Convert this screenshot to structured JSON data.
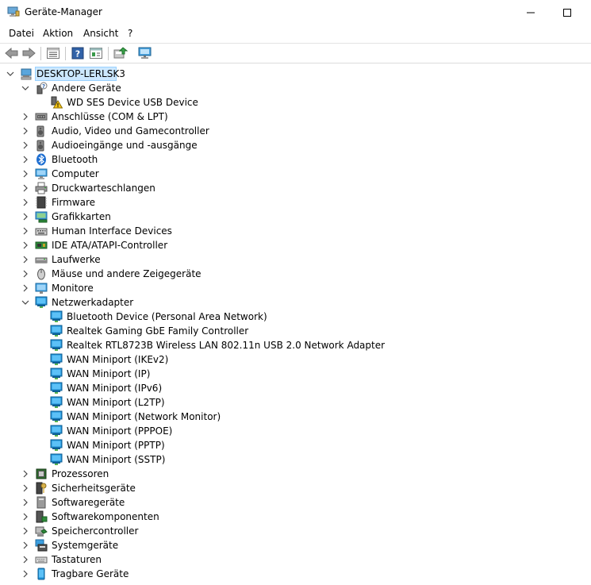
{
  "window": {
    "title": "Geräte-Manager"
  },
  "menu": {
    "items": [
      "Datei",
      "Aktion",
      "Ansicht",
      "?"
    ]
  },
  "toolbar": {
    "buttons": [
      "back-icon",
      "forward-icon",
      "properties-list-icon",
      "help-icon",
      "view-icon",
      "update-driver-icon",
      "monitor-scan-icon"
    ]
  },
  "tree": {
    "root": "DESKTOP-LERLSK3",
    "categories": [
      {
        "label": "Andere Geräte",
        "expanded": true,
        "icon": "unknown-device-icon",
        "children": [
          {
            "label": "WD SES Device USB Device",
            "icon": "warning-device-icon"
          }
        ]
      },
      {
        "label": "Anschlüsse (COM & LPT)",
        "icon": "port-icon"
      },
      {
        "label": "Audio, Video und Gamecontroller",
        "icon": "speaker-icon"
      },
      {
        "label": "Audioeingänge und -ausgänge",
        "icon": "speaker-icon"
      },
      {
        "label": "Bluetooth",
        "icon": "bluetooth-icon"
      },
      {
        "label": "Computer",
        "icon": "computer-icon"
      },
      {
        "label": "Druckwarteschlangen",
        "icon": "printer-icon"
      },
      {
        "label": "Firmware",
        "icon": "chip-icon"
      },
      {
        "label": "Grafikkarten",
        "icon": "display-adapter-icon"
      },
      {
        "label": "Human Interface Devices",
        "icon": "hid-icon"
      },
      {
        "label": "IDE ATA/ATAPI-Controller",
        "icon": "ide-controller-icon"
      },
      {
        "label": "Laufwerke",
        "icon": "drive-icon"
      },
      {
        "label": "Mäuse und andere Zeigegeräte",
        "icon": "mouse-icon"
      },
      {
        "label": "Monitore",
        "icon": "monitor-icon"
      },
      {
        "label": "Netzwerkadapter",
        "expanded": true,
        "icon": "network-icon",
        "children": [
          {
            "label": "Bluetooth Device (Personal Area Network)",
            "icon": "network-icon"
          },
          {
            "label": "Realtek Gaming GbE Family Controller",
            "icon": "network-icon"
          },
          {
            "label": "Realtek RTL8723B Wireless LAN 802.11n USB 2.0 Network Adapter",
            "icon": "network-icon"
          },
          {
            "label": "WAN Miniport (IKEv2)",
            "icon": "network-icon"
          },
          {
            "label": "WAN Miniport (IP)",
            "icon": "network-icon"
          },
          {
            "label": "WAN Miniport (IPv6)",
            "icon": "network-icon"
          },
          {
            "label": "WAN Miniport (L2TP)",
            "icon": "network-icon"
          },
          {
            "label": "WAN Miniport (Network Monitor)",
            "icon": "network-icon"
          },
          {
            "label": "WAN Miniport (PPPOE)",
            "icon": "network-icon"
          },
          {
            "label": "WAN Miniport (PPTP)",
            "icon": "network-icon"
          },
          {
            "label": "WAN Miniport (SSTP)",
            "icon": "network-icon"
          }
        ]
      },
      {
        "label": "Prozessoren",
        "icon": "processor-icon"
      },
      {
        "label": "Sicherheitsgeräte",
        "icon": "security-device-icon"
      },
      {
        "label": "Softwaregeräte",
        "icon": "software-device-icon"
      },
      {
        "label": "Softwarekomponenten",
        "icon": "software-component-icon"
      },
      {
        "label": "Speichercontroller",
        "icon": "storage-controller-icon"
      },
      {
        "label": "Systemgeräte",
        "icon": "system-device-icon"
      },
      {
        "label": "Tastaturen",
        "icon": "keyboard-icon"
      },
      {
        "label": "Tragbare Geräte",
        "icon": "portable-device-icon"
      }
    ]
  },
  "colors": {
    "selection": "#cce8ff",
    "selection_border": "#99d1ff",
    "network_blue": "#1e90d6"
  }
}
